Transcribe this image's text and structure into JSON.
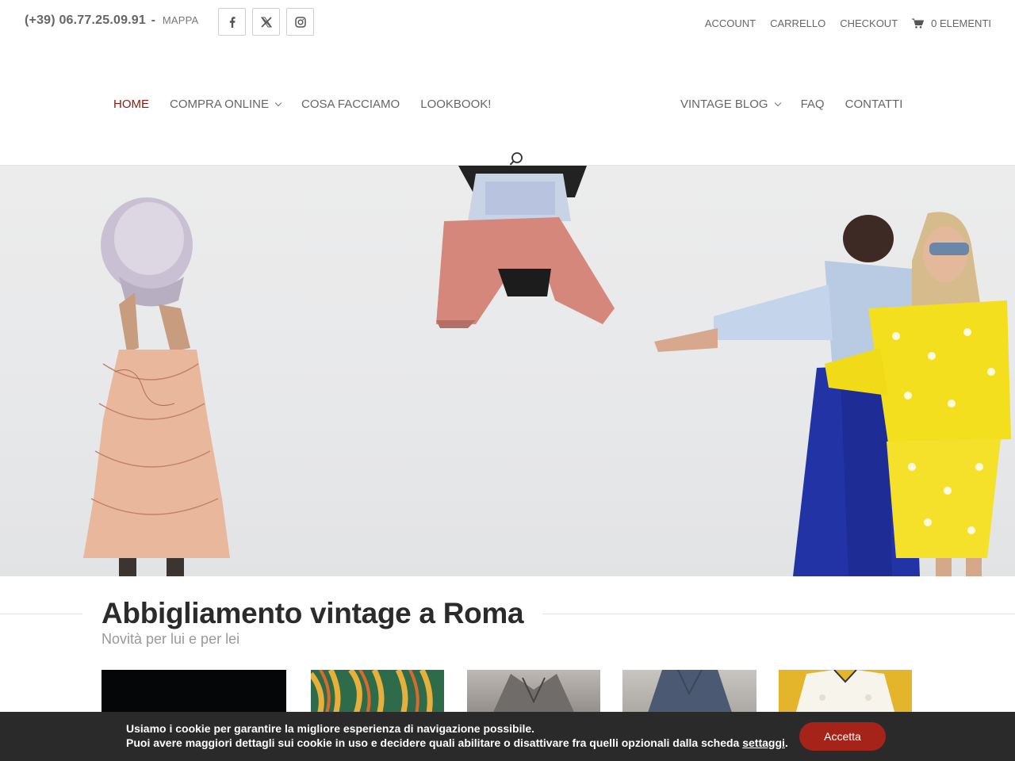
{
  "topbar": {
    "phone": "(+39) 06.77.25.09.91",
    "separator": "-",
    "map_link": "MAPPA",
    "socials": [
      {
        "name": "facebook-icon"
      },
      {
        "name": "x-twitter-icon"
      },
      {
        "name": "instagram-icon"
      }
    ],
    "secondary_nav": {
      "account": "ACCOUNT",
      "cart": "CARRELLO",
      "checkout": "CHECKOUT",
      "cart_count": "0 ELEMENTI",
      "cart_icon": "shopping-cart-icon"
    }
  },
  "main_nav": {
    "left": [
      {
        "label": "HOME",
        "active": true
      },
      {
        "label": "COMPRA ONLINE",
        "dropdown": true
      },
      {
        "label": "COSA FACCIAMO"
      },
      {
        "label": "LOOKBOOK!"
      }
    ],
    "right": [
      {
        "label": "VINTAGE BLOG",
        "dropdown": true
      },
      {
        "label": "FAQ"
      },
      {
        "label": "CONTATTI"
      }
    ],
    "search_icon": "search-icon"
  },
  "section": {
    "title": "Abbigliamento vintage a Roma",
    "subtitle": "Novità per lui e per lei"
  },
  "cookie_banner": {
    "line1": "Usiamo i cookie per garantire la migliore esperienza di navigazione possibile.",
    "line2_prefix": "Puoi avere maggiori dettagli sui cookie in uso e decidere quali abilitare o disattivare fra quelli opzionali dalla scheda",
    "line2_link": "settaggi",
    "line2_suffix": ".",
    "accept": "Accetta"
  },
  "colors": {
    "accent": "#8b1a12",
    "button": "#a62319",
    "banner_bg": "#2a2a2a",
    "title": "#2b2b2b"
  }
}
